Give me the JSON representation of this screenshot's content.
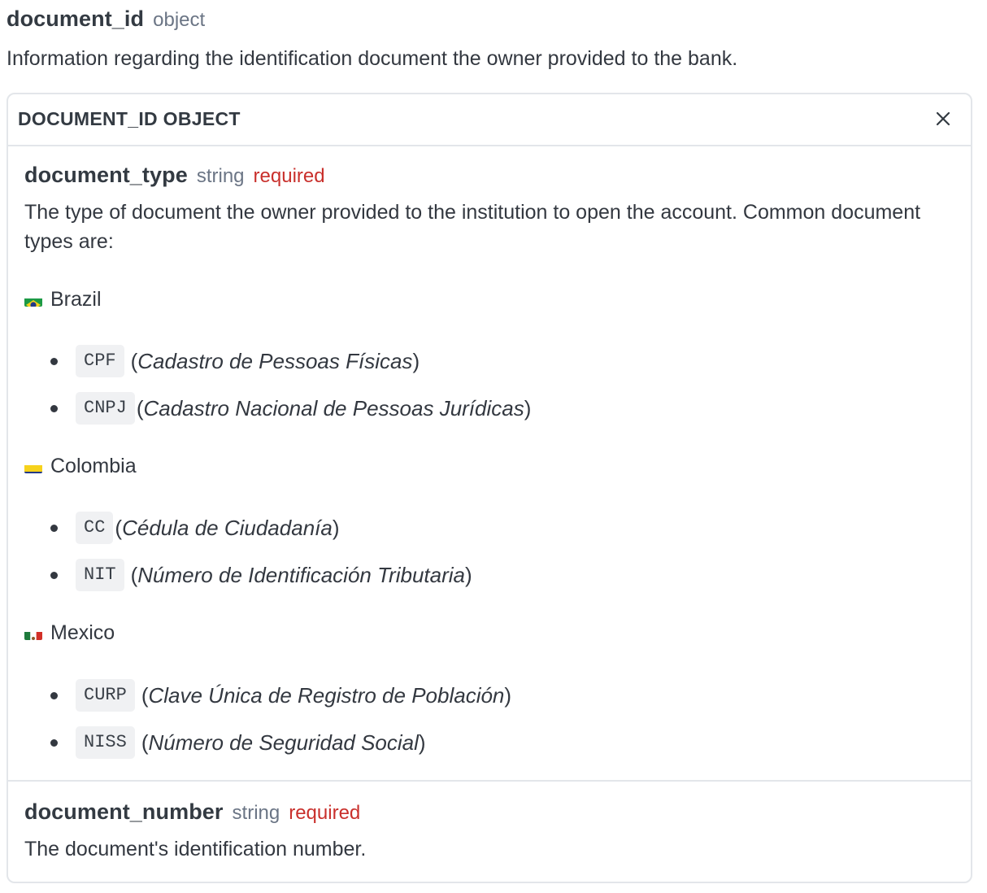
{
  "field": {
    "name": "document_id",
    "type": "object",
    "description": "Information regarding the identification document the owner provided to the bank."
  },
  "panel": {
    "title": "DOCUMENT_ID OBJECT",
    "close_icon": "close-icon"
  },
  "document_type": {
    "name": "document_type",
    "type": "string",
    "required": "required",
    "description": "The type of document the owner provided to the institution to open the account. Common document types are:"
  },
  "countries": [
    {
      "name": "Brazil",
      "flag": "brazil-flag-icon",
      "documents": [
        {
          "code": "CPF",
          "full_name": "Cadastro de Pessoas Físicas"
        },
        {
          "code": "CNPJ",
          "full_name": "Cadastro Nacional de Pessoas Jurídicas"
        }
      ]
    },
    {
      "name": "Colombia",
      "flag": "colombia-flag-icon",
      "documents": [
        {
          "code": "CC",
          "full_name": "Cédula de Ciudadanía"
        },
        {
          "code": "NIT",
          "full_name": "Número de Identificación Tributaria"
        }
      ]
    },
    {
      "name": "Mexico",
      "flag": "mexico-flag-icon",
      "documents": [
        {
          "code": "CURP",
          "full_name": "Clave Única de Registro de Población"
        },
        {
          "code": "NISS",
          "full_name": "Número de Seguridad Social"
        }
      ]
    }
  ],
  "document_number": {
    "name": "document_number",
    "type": "string",
    "required": "required",
    "description": "The document's identification number."
  },
  "colors": {
    "required": "#c9302c",
    "type": "#6b7585",
    "text": "#333840",
    "border": "#e3e6ea",
    "code_bg": "#f0f1f3"
  }
}
